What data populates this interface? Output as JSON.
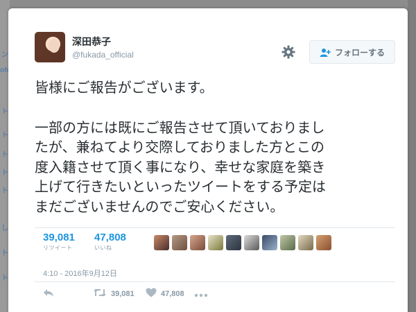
{
  "background": {
    "left_labels": [
      "ン",
      "oNi",
      "ト",
      "ト",
      "ト",
      "ト",
      "ト",
      "し",
      "ト",
      "ト"
    ]
  },
  "tweet": {
    "display_name": "深田恭子",
    "handle": "@fukada_official",
    "follow_label": "フォローする",
    "text_lines": [
      "皆様にご報告がございます。",
      "",
      "一部の方には既にご報告させて頂いておりまし",
      "たが、兼ねてより交際しておりました方とこの",
      "度入籍させて頂く事になり、幸せな家庭を築き",
      "上げて行きたいといったツイートをする予定は",
      "まだございませんのでご安心ください。"
    ],
    "retweets": {
      "count": "39,081",
      "label": "リツイート"
    },
    "likes": {
      "count": "47,808",
      "label": "いいね"
    },
    "liker_avatar_count": 10,
    "timestamp": "4:10 - 2016年9月12日",
    "actions": {
      "retweet_count": "39,081",
      "like_count": "47,808"
    }
  },
  "colors": {
    "link_blue": "#1b95e0",
    "muted": "#8899a6",
    "text": "#292f33",
    "border": "#e1e8ed"
  },
  "icons": {
    "gear": "gear-icon",
    "follow": "add-user-icon",
    "reply": "reply-icon",
    "retweet": "retweet-icon",
    "like": "heart-icon",
    "more": "more-dots-icon"
  }
}
